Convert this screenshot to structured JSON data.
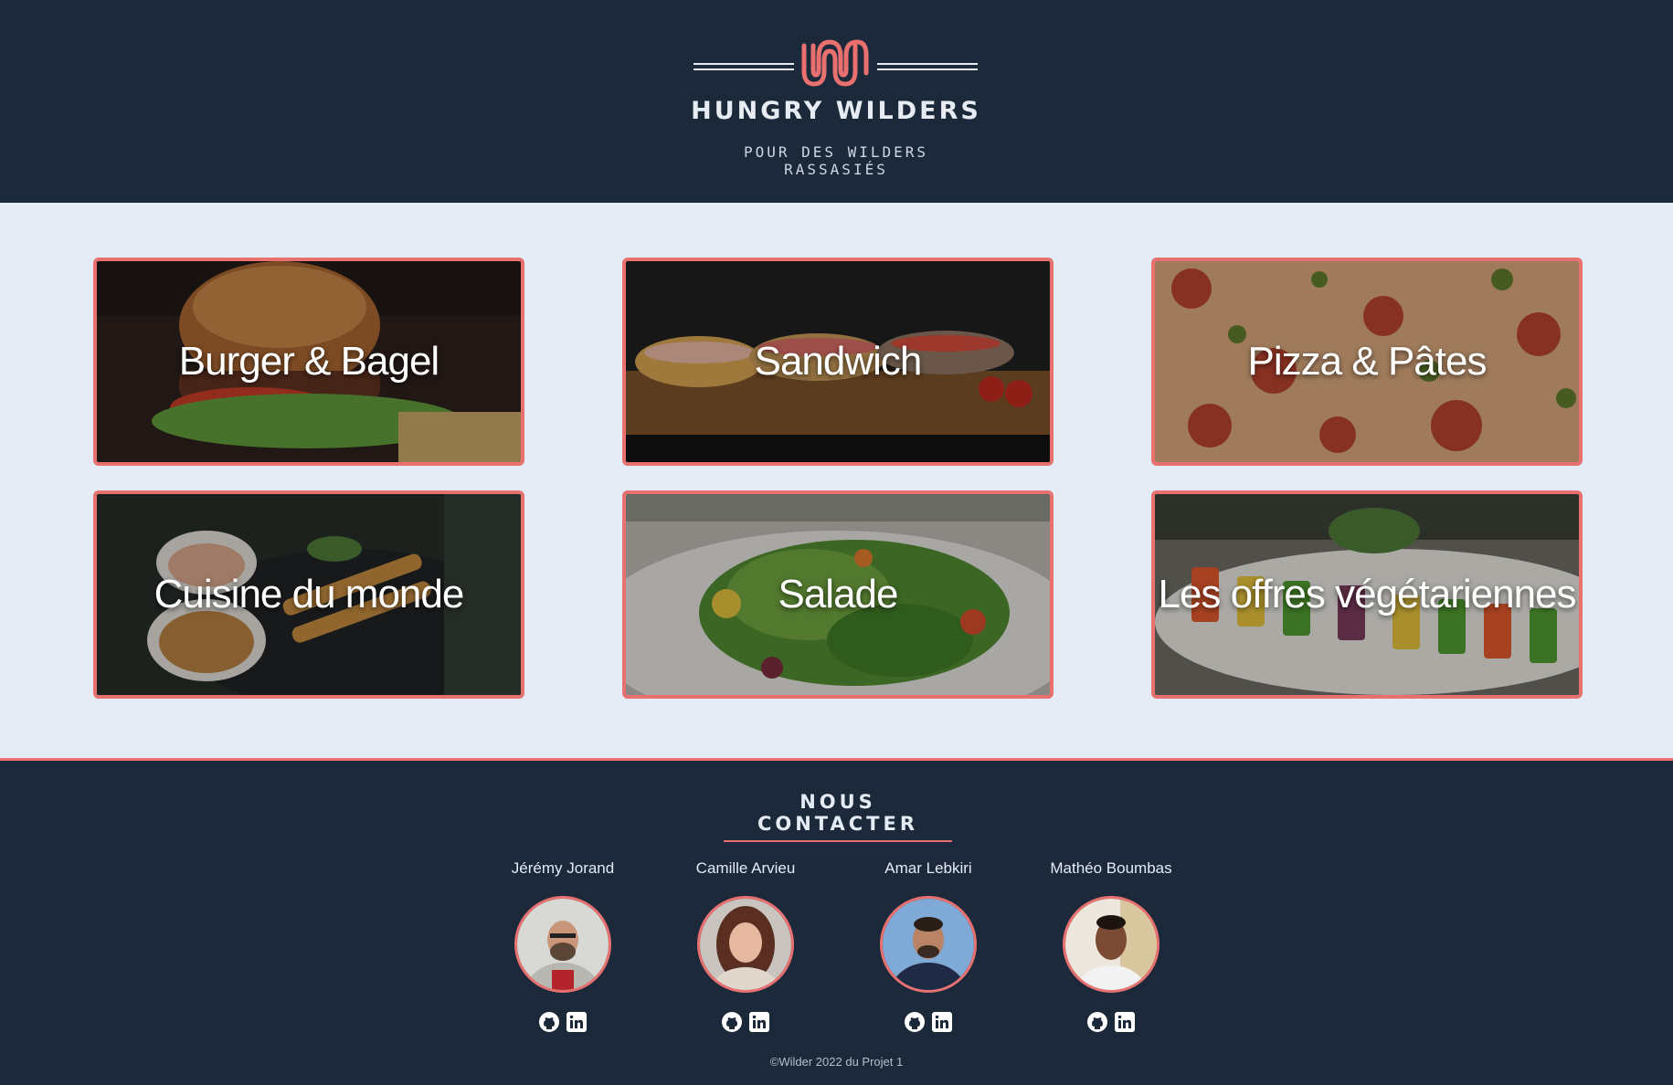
{
  "header": {
    "brand": "HUNGRY WILDERS",
    "tagline": "POUR DES WILDERS RASSASIÉS",
    "logo_icon": "wave-w-logo",
    "accent_color": "#e8706f",
    "background_color": "#1b293b"
  },
  "categories": [
    {
      "label": "Burger & Bagel",
      "image": "burger-photo"
    },
    {
      "label": "Sandwich",
      "image": "sandwich-photo"
    },
    {
      "label": "Pizza & Pâtes",
      "image": "pizza-photo"
    },
    {
      "label": "Cuisine du monde",
      "image": "satay-photo"
    },
    {
      "label": "Salade",
      "image": "salad-photo"
    },
    {
      "label": "Les offres végétariennes",
      "image": "vegetable-skewers-photo"
    }
  ],
  "footer": {
    "contact_title": "NOUS CONTACTER",
    "members": [
      {
        "name": "Jérémy Jorand",
        "icons": [
          "github-icon",
          "linkedin-icon"
        ]
      },
      {
        "name": "Camille Arvieu",
        "icons": [
          "github-icon",
          "linkedin-icon"
        ]
      },
      {
        "name": "Amar Lebkiri",
        "icons": [
          "github-icon",
          "linkedin-icon"
        ]
      },
      {
        "name": "Mathéo Boumbas",
        "icons": [
          "github-icon",
          "linkedin-icon"
        ]
      }
    ],
    "copyright": "©Wilder 2022 du Projet 1"
  }
}
